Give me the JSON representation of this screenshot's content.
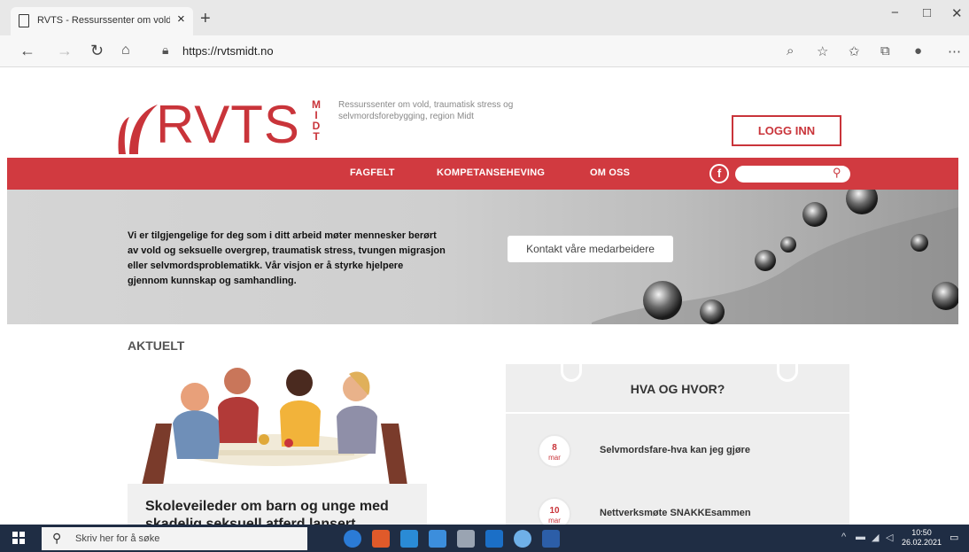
{
  "browser": {
    "tab_title": "RVTS - Ressurssenter om vold, t",
    "new_tab_symbol": "+",
    "close_tab_symbol": "×",
    "url": "https://rvtsmidt.no",
    "window_controls": {
      "minimize": "−",
      "restore": "□",
      "close": "✕"
    }
  },
  "header": {
    "logo_text": "RVTS",
    "logo_sub": "M I D T",
    "tagline": "Ressurssenter om vold, traumatisk stress og selvmordsforebygging, region Midt",
    "login_label": "LOGG INN",
    "brand_color": "#c9343a"
  },
  "nav": {
    "items": [
      {
        "label": "FAGFELT"
      },
      {
        "label": "KOMPETANSEHEVING"
      },
      {
        "label": "OM OSS"
      }
    ],
    "facebook_label": "f",
    "search_placeholder": ""
  },
  "hero": {
    "text": "Vi er tilgjengelige for deg som i ditt arbeid møter mennesker berørt av vold og seksuelle overgrep, traumatisk stress, tvungen migrasjon eller selvmordsproblematikk. Vår visjon er å styrke hjelpere gjennom kunnskap og samhandling.",
    "contact_label": "Kontakt våre medarbeidere"
  },
  "news": {
    "section_title": "AKTUELT",
    "article_title": "Skoleveileder om barn og unge med skadelig seksuell atferd lansert"
  },
  "calendar": {
    "title": "HVA OG HVOR?",
    "events": [
      {
        "day": "8",
        "month": "mar",
        "title": "Selvmordsfare-hva kan jeg gjøre"
      },
      {
        "day": "10",
        "month": "mar",
        "title": "Nettverksmøte SNAKKEsammen"
      }
    ]
  },
  "taskbar": {
    "search_placeholder": "Skriv her for å søke",
    "time": "10:50",
    "date": "26.02.2021"
  }
}
